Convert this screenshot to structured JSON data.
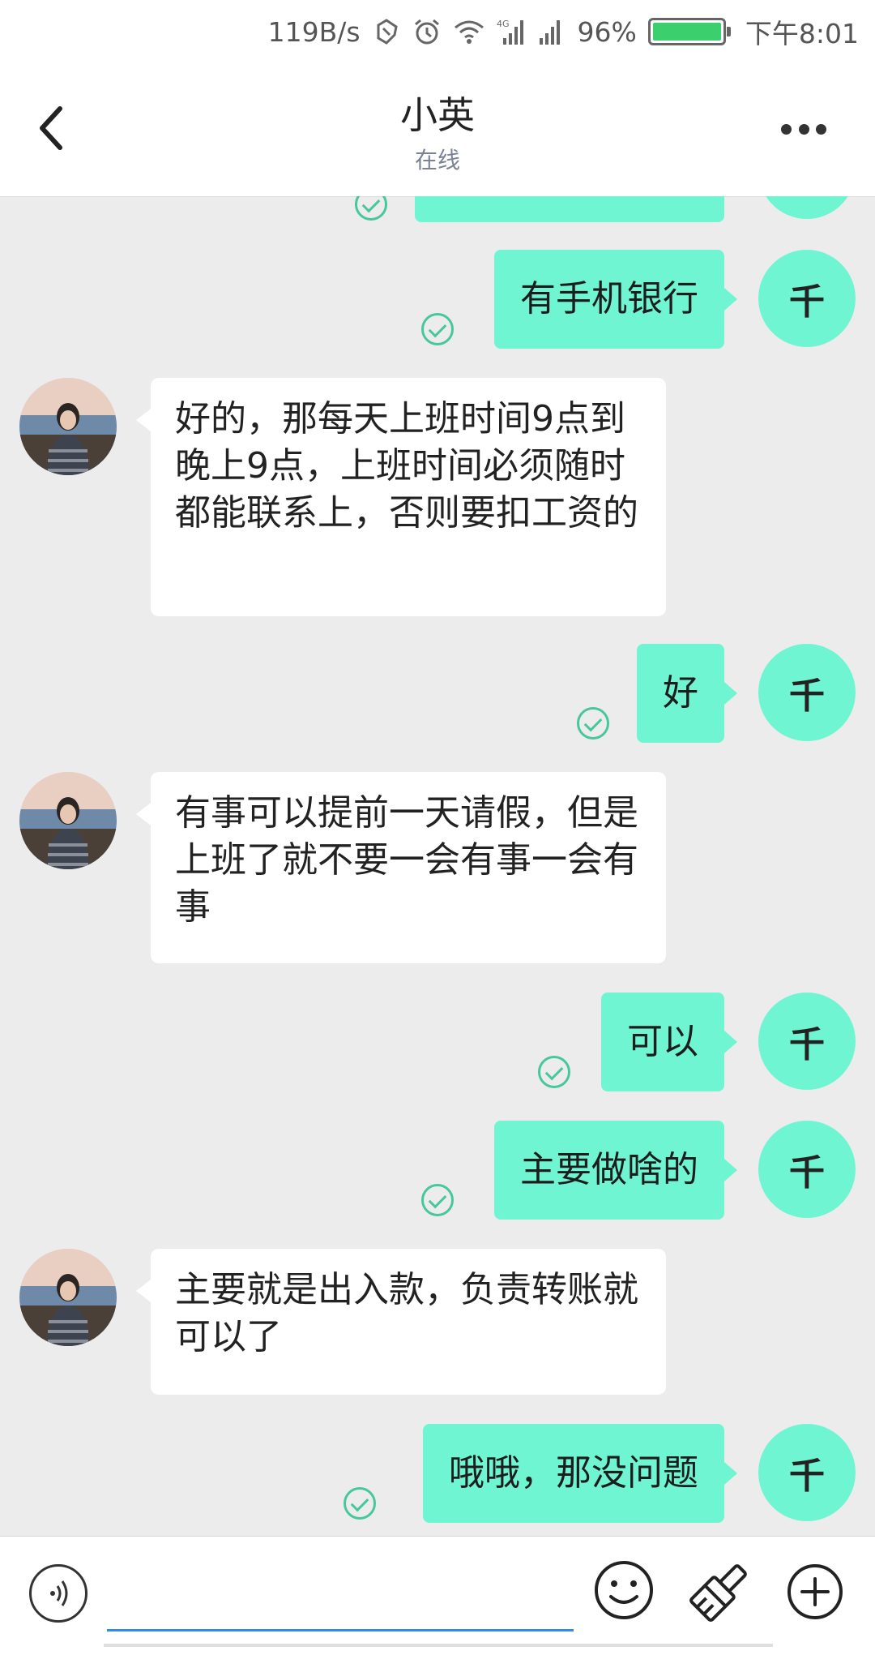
{
  "status_bar": {
    "net_speed": "119B/s",
    "battery_percent": "96%",
    "time": "下午8:01",
    "icons": [
      "nfc-icon",
      "alarm-icon",
      "wifi-icon",
      "4g-signal-icon",
      "signal-icon",
      "battery-icon"
    ]
  },
  "header": {
    "title": "小英",
    "subtitle": "在线"
  },
  "avatars": {
    "me_initial": "千"
  },
  "messages": [
    {
      "dir": "out",
      "text": "有手机银行"
    },
    {
      "dir": "in",
      "text": "好的，那每天上班时间9点到晚上9点，上班时间必须随时都能联系上，否则要扣工资的"
    },
    {
      "dir": "out",
      "text": "好"
    },
    {
      "dir": "in",
      "text": "有事可以提前一天请假，但是上班了就不要一会有事一会有事"
    },
    {
      "dir": "out",
      "text": "可以"
    },
    {
      "dir": "out",
      "text": "主要做啥的"
    },
    {
      "dir": "in",
      "text": "主要就是出入款，负责转账就可以了"
    },
    {
      "dir": "out",
      "text": "哦哦，那没问题"
    }
  ],
  "colors": {
    "accent": "#6ff5d2",
    "check": "#47c89a",
    "input_line": "#2d8cf0"
  }
}
